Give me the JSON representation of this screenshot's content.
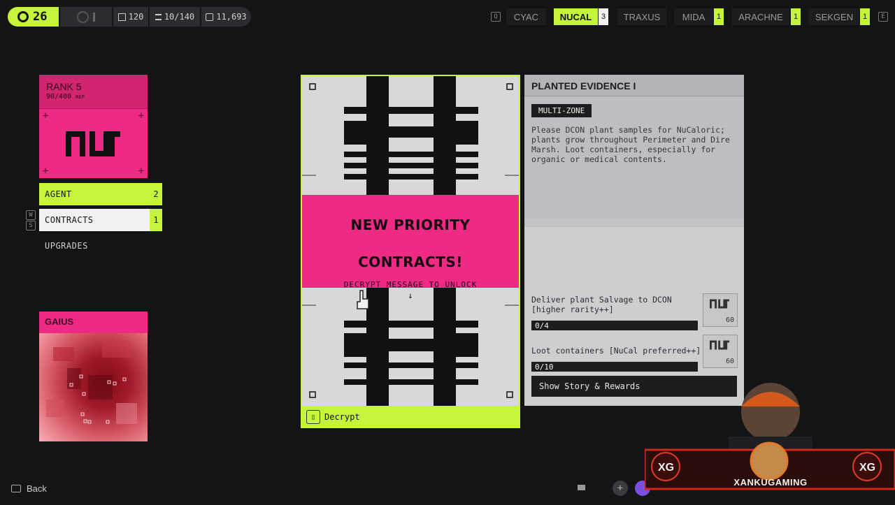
{
  "topbar": {
    "level": "26",
    "stats": [
      {
        "icon": "crate-icon",
        "value": "120"
      },
      {
        "icon": "stash-icon",
        "value": "10/140"
      },
      {
        "icon": "credits-icon",
        "value": "11,693"
      }
    ],
    "left_key": "Q",
    "right_key": "E",
    "factions": [
      {
        "name": "CYAC",
        "count": ""
      },
      {
        "name": "NUCAL",
        "count": "3"
      },
      {
        "name": "TRAXUS",
        "count": ""
      },
      {
        "name": "MIDA",
        "count": "1"
      },
      {
        "name": "ARACHNE",
        "count": "1"
      },
      {
        "name": "SEKGEN",
        "count": "1"
      }
    ]
  },
  "rank": {
    "title": "RANK 5",
    "rep": "90/400",
    "rep_label": "REP"
  },
  "menu": {
    "agent": {
      "label": "AGENT",
      "count": "2"
    },
    "contracts": {
      "label": "CONTRACTS",
      "count": "1"
    },
    "upgrades": {
      "label": "UPGRADES"
    },
    "key_w": "W",
    "key_s": "S"
  },
  "handler": {
    "name": "GAIUS"
  },
  "contract_card": {
    "headline_1": "NEW PRIORITY",
    "headline_2": "CONTRACTS!",
    "subtext": "DECRYPT MESSAGE TO UNLOCK",
    "arrow": "↓",
    "action": "Decrypt"
  },
  "details": {
    "title": "PLANTED EVIDENCE I",
    "tag": "MULTI-ZONE",
    "description": "Please DCON plant samples for NuCaloric; plants grow throughout Perimeter and Dire Marsh. Loot containers, especially for organic or medical contents.",
    "objectives": [
      {
        "text_1": "Deliver plant Salvage to DCON",
        "text_2": "[higher rarity++]",
        "progress": "0/4",
        "reward": "60"
      },
      {
        "text_1": "Loot containers [NuCal preferred++]",
        "text_2": "",
        "progress": "0/10",
        "reward": "60"
      }
    ],
    "story_button": "Show Story & Rewards"
  },
  "footer": {
    "back_label": "Back",
    "streamer": "XANKUGAMING"
  },
  "colors": {
    "accent": "#c5f53a",
    "pink": "#ee2a84",
    "bg": "#131415"
  }
}
